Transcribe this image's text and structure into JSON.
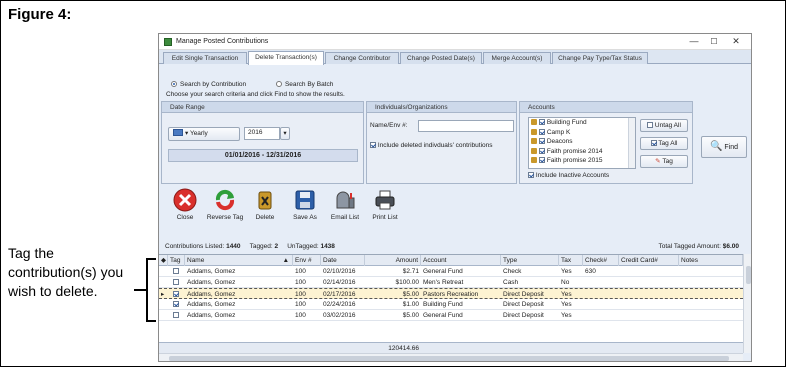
{
  "figure": {
    "title": "Figure 4:",
    "annotation": "Tag the contribution(s) you wish to delete."
  },
  "window": {
    "title": "Manage Posted Contributions",
    "controls": {
      "minimize": "—",
      "maximize": "☐",
      "close": "✕"
    }
  },
  "tabs": [
    {
      "label": "Edit Single Transaction"
    },
    {
      "label": "Delete Transaction(s)"
    },
    {
      "label": "Change Contributor"
    },
    {
      "label": "Change Posted Date(s)"
    },
    {
      "label": "Merge Account(s)"
    },
    {
      "label": "Change Pay Type/Tax Status"
    }
  ],
  "active_tab": "Delete Transaction(s)",
  "search": {
    "by_contribution": "Search by Contribution",
    "by_batch": "Search By Batch",
    "selected": "Search by Contribution",
    "instructions": "Choose your search criteria and click Find to show the results."
  },
  "date_range": {
    "header": "Date Range",
    "period": "Yearly",
    "year": "2016",
    "range": "01/01/2016 - 12/31/2016"
  },
  "individuals": {
    "header": "Individuals/Organizations",
    "name_label": "Name/Env #:",
    "name_value": "",
    "include_deleted": "Include deleted indivduals' contributions",
    "include_deleted_checked": true
  },
  "accounts": {
    "header": "Accounts",
    "items": [
      {
        "label": "Building Fund",
        "checked": true
      },
      {
        "label": "Camp K",
        "checked": true
      },
      {
        "label": "Deacons",
        "checked": true
      },
      {
        "label": "Faith promise 2014",
        "checked": true
      },
      {
        "label": "Faith promise 2015",
        "checked": true
      }
    ],
    "untag_all": "Untag All",
    "tag_all": "Tag All",
    "tag": "Tag",
    "include_inactive": "Include Inactive Accounts",
    "include_inactive_checked": true
  },
  "find_label": "Find",
  "toolbar": [
    {
      "label": "Close",
      "icon": "close-icon"
    },
    {
      "label": "Reverse Tag",
      "icon": "reverse-tag-icon"
    },
    {
      "label": "Delete",
      "icon": "delete-icon"
    },
    {
      "label": "Save As",
      "icon": "save-icon"
    },
    {
      "label": "Email List",
      "icon": "mailbox-icon"
    },
    {
      "label": "Print List",
      "icon": "printer-icon"
    }
  ],
  "counts": {
    "listed_label": "Contributions Listed:",
    "listed": "1440",
    "tagged_label": "Tagged:",
    "tagged": "2",
    "untagged_label": "UnTagged:",
    "untagged": "1438",
    "total_label": "Total Tagged Amount:",
    "total": "$6.00"
  },
  "grid": {
    "columns": [
      "Tag",
      "Name",
      "Env #",
      "Date",
      "Amount",
      "Account",
      "Type",
      "Tax",
      "Check#",
      "Credit Card#",
      "Notes"
    ],
    "rows": [
      {
        "tagged": false,
        "selected": false,
        "name": "Addams, Gomez",
        "env": "100",
        "date": "02/10/2016",
        "amount": "$2.71",
        "account": "General Fund",
        "type": "Check",
        "tax": "Yes",
        "check": "630",
        "card": "",
        "notes": ""
      },
      {
        "tagged": false,
        "selected": false,
        "name": "Addams, Gomez",
        "env": "100",
        "date": "02/14/2016",
        "amount": "$100.00",
        "account": "Men's Retreat",
        "type": "Cash",
        "tax": "No",
        "check": "",
        "card": "",
        "notes": ""
      },
      {
        "tagged": true,
        "selected": true,
        "name": "Addams, Gomez",
        "env": "100",
        "date": "02/17/2016",
        "amount": "$5.00",
        "account": "Pastors Recreation",
        "type": "Direct Deposit",
        "tax": "Yes",
        "check": "",
        "card": "",
        "notes": ""
      },
      {
        "tagged": true,
        "selected": false,
        "name": "Addams, Gomez",
        "env": "100",
        "date": "02/24/2016",
        "amount": "$1.00",
        "account": "Building Fund",
        "type": "Direct Deposit",
        "tax": "Yes",
        "check": "",
        "card": "",
        "notes": ""
      },
      {
        "tagged": false,
        "selected": false,
        "name": "Addams, Gomez",
        "env": "100",
        "date": "03/02/2016",
        "amount": "$5.00",
        "account": "General Fund",
        "type": "Direct Deposit",
        "tax": "Yes",
        "check": "",
        "card": "",
        "notes": ""
      }
    ],
    "footer_total": "120414.66"
  },
  "colors": {
    "window_bg": "#e6edf7",
    "panel_header": "#cdd9ea",
    "selected_row": "#fdf3d2",
    "close_red": "#d9302c"
  }
}
